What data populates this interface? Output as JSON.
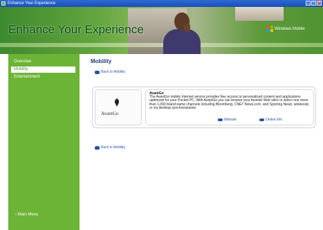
{
  "window": {
    "title": "Enhance Your Experience",
    "controls": [
      "_",
      "□",
      "×"
    ]
  },
  "banner": {
    "heading": "Enhance Your Experience",
    "logo_text": "Windows Mobile"
  },
  "sidebar": {
    "items": [
      {
        "label": "Overview"
      },
      {
        "label": "Mobility"
      },
      {
        "label": "Entertainment"
      }
    ],
    "active_index": 1,
    "main_menu": "‹ Main Menu"
  },
  "main": {
    "heading": "Mobility",
    "back_link_top": "Back to Mobility",
    "back_link_bottom": "Back to Mobility",
    "card": {
      "logo_wordmark": "AvantGo",
      "name": "AvantGo",
      "description": "The AvantGo mobile Internet service provides free access to personalized content and applications optimized for your Pocket PC. With AvantGo you can browse your favorite Web sites or select one more than 1,000 brand-name channels including Bloomberg, CNET News.com, and Sporting News; wirelessly or via desktop synchronization.",
      "website_link": "Website",
      "online_info_link": "Online Info"
    }
  },
  "colors": {
    "sidebar_green": "#6cb435",
    "link_blue": "#2a52a8",
    "title_blue": "#1f3b6f"
  }
}
